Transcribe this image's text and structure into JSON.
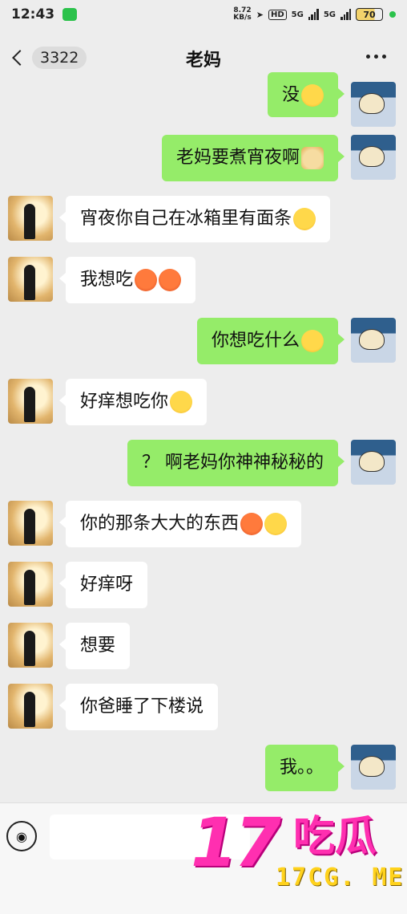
{
  "status_bar": {
    "time": "12:43",
    "speed_value": "8.72",
    "speed_unit": "KB/s",
    "hd": "HD",
    "net1": "5G",
    "net2": "5G",
    "battery": "70"
  },
  "header": {
    "unread_count": "3322",
    "title": "老妈"
  },
  "messages": [
    {
      "side": "sent",
      "text": "没",
      "emoji": "wink"
    },
    {
      "side": "sent",
      "text": "老妈要煮宵夜啊",
      "emoji": "doge"
    },
    {
      "side": "recv",
      "text": "宵夜你自己在冰箱里有面条",
      "emoji": "hug"
    },
    {
      "side": "recv",
      "text": "我想吃",
      "emoji": "angry-angry"
    },
    {
      "side": "sent",
      "text": "你想吃什么",
      "emoji": "laugh"
    },
    {
      "side": "recv",
      "text": "好痒想吃你",
      "emoji": "hug"
    },
    {
      "side": "sent",
      "text": "？ 啊老妈你神神秘秘的",
      "emoji": ""
    },
    {
      "side": "recv",
      "text": "你的那条大大的东西",
      "emoji": "angry-sly"
    },
    {
      "side": "recv",
      "text": "好痒呀",
      "emoji": ""
    },
    {
      "side": "recv",
      "text": "想要",
      "emoji": ""
    },
    {
      "side": "recv",
      "text": "你爸睡了下楼说",
      "emoji": ""
    },
    {
      "side": "sent",
      "text": "我。。",
      "emoji": ""
    }
  ],
  "watermark": {
    "number": "17",
    "chinese": "吃瓜",
    "url": "17CG. ME"
  },
  "colors": {
    "sent_bubble": "#95ec69",
    "recv_bubble": "#ffffff",
    "background": "#ededed",
    "watermark_pink": "#ff2fb0",
    "watermark_yellow": "#ffd21c"
  }
}
